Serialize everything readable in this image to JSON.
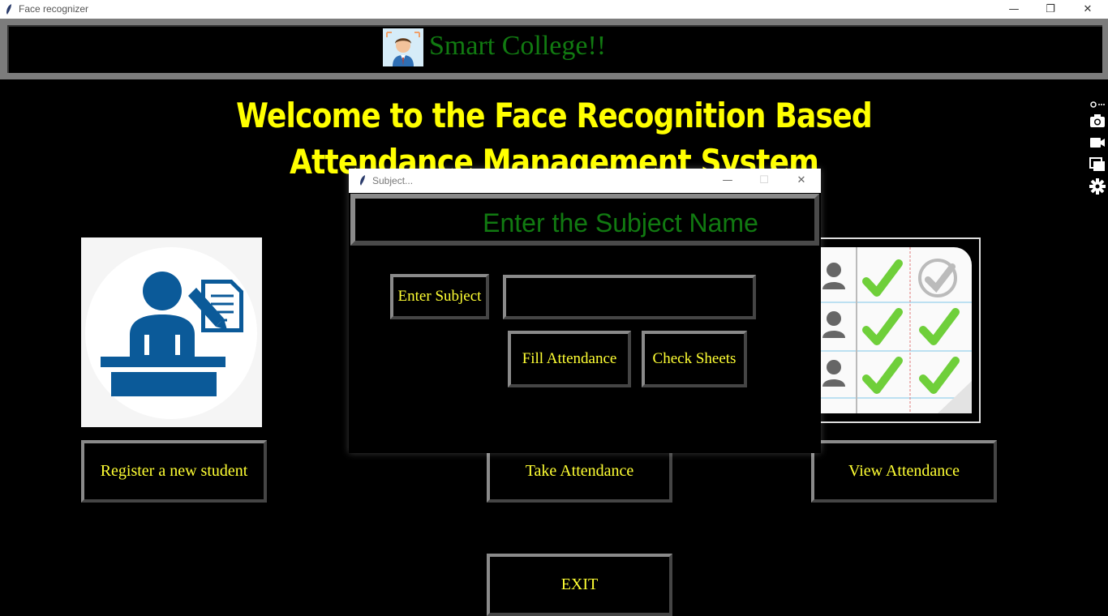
{
  "window": {
    "title": "Face recognizer",
    "controls": {
      "minimize": "—",
      "restore": "❐",
      "close": "✕"
    }
  },
  "header": {
    "brand": "Smart College!!"
  },
  "welcome": {
    "line1": "Welcome to the Face Recognition Based",
    "line2": "Attendance Management System"
  },
  "buttons": {
    "register": "Register a new student",
    "take": "Take Attendance",
    "view": "View Attendance",
    "exit": "EXIT"
  },
  "dialog": {
    "title": "Subject...",
    "heading": "Enter the Subject Name",
    "enter_subject_label": "Enter Subject",
    "subject_value": "",
    "fill_attendance": "Fill Attendance",
    "check_sheets": "Check Sheets",
    "controls": {
      "minimize": "—",
      "maximize": "☐",
      "close": "✕"
    }
  },
  "toolbar": {
    "icons": [
      "link-icon",
      "more-icon",
      "camera-icon",
      "video-icon",
      "window-icon",
      "gear-icon"
    ]
  },
  "colors": {
    "accent_yellow": "#ffff00",
    "brand_green": "#117a11",
    "frame_gray": "#7c7c7c",
    "background": "#000000"
  }
}
